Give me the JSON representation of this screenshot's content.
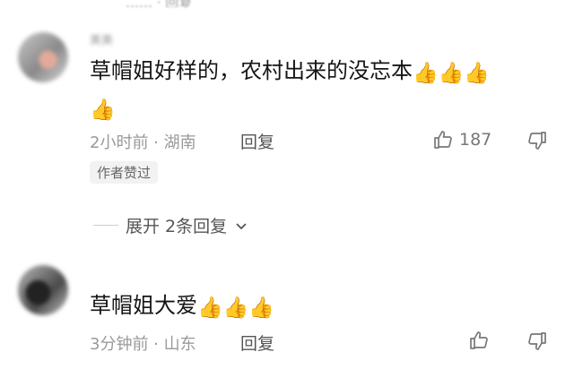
{
  "top_fragment": "…… · 回复",
  "comments": [
    {
      "username": "美美",
      "text": "草帽姐好样的，农村出来的没忘本",
      "emojis": [
        "👍",
        "👍",
        "👍",
        "👍"
      ],
      "time_location": "2小时前 · 湖南",
      "reply_label": "回复",
      "like_count": "187",
      "author_badge": "作者赞过",
      "expand_label": "展开 2条回复"
    },
    {
      "username": "",
      "text": "草帽姐大爱",
      "emojis": [
        "👍",
        "👍",
        "👍"
      ],
      "time_location": "3分钟前 · 山东",
      "reply_label": "回复",
      "like_count": ""
    }
  ],
  "icons": {
    "like": "thumbs-up-outline-icon",
    "dislike": "thumbs-down-outline-icon",
    "expand": "chevron-down-icon"
  },
  "colors": {
    "meta": "#9a9a9a",
    "text": "#151515",
    "badge_bg": "#f2f2f2"
  }
}
